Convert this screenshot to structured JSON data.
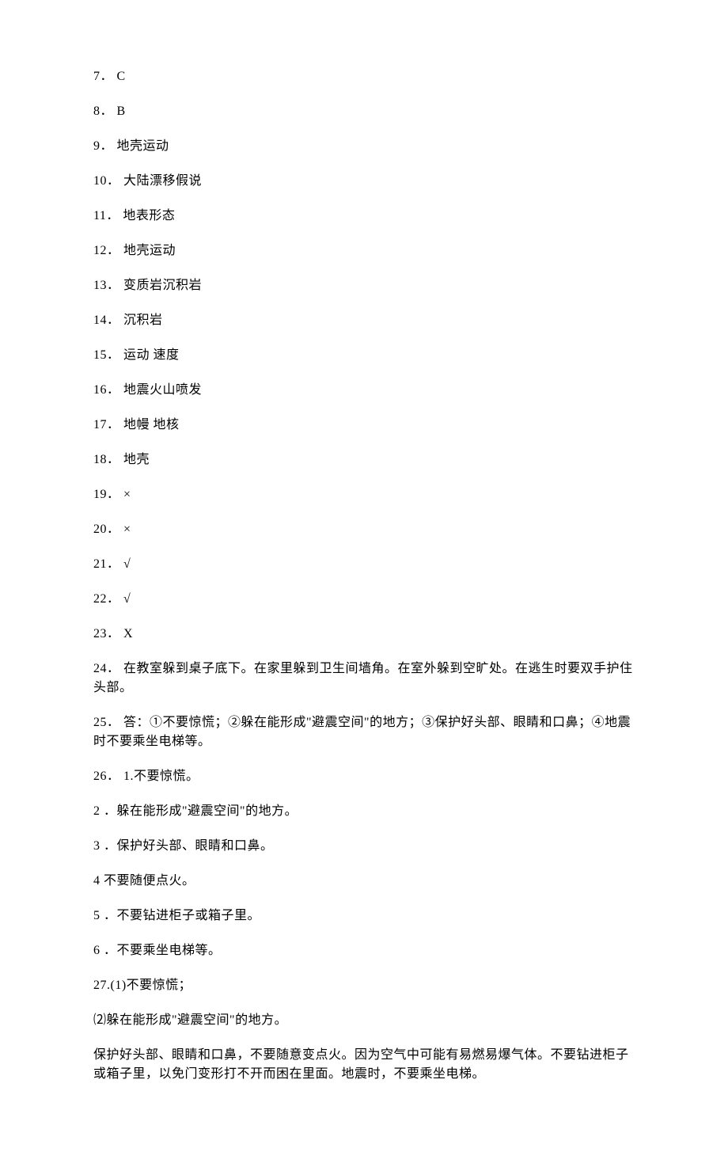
{
  "lines": [
    "7． C",
    "8． B",
    "9． 地壳运动",
    "10． 大陆漂移假说",
    "11． 地表形态",
    "12． 地壳运动",
    "13． 变质岩沉积岩",
    "14． 沉积岩",
    "15． 运动 速度",
    "16． 地震火山喷发",
    "17． 地幔 地核",
    "18． 地壳",
    "19． ×",
    "20． ×",
    "21． √",
    "22． √",
    "23． X",
    "24． 在教室躲到桌子底下。在家里躲到卫生间墙角。在室外躲到空旷处。在逃生时要双手护住头部。",
    "25． 答：①不要惊慌；②躲在能形成\"避震空间\"的地方；③保护好头部、眼睛和口鼻；④地震时不要乘坐电梯等。",
    "26． 1.不要惊慌。",
    "2 ．躲在能形成\"避震空间\"的地方。",
    "3 ．保护好头部、眼睛和口鼻。",
    "4 不要随便点火。",
    "5 ．不要钻进柜子或箱子里。",
    "6 ．不要乘坐电梯等。",
    "27.(1)不要惊慌；",
    "⑵躲在能形成\"避震空间\"的地方。",
    "保护好头部、眼睛和口鼻，不要随意变点火。因为空气中可能有易燃易爆气体。不要钻进柜子或箱子里，以免门变形打不开而困在里面。地震时，不要乘坐电梯。"
  ]
}
